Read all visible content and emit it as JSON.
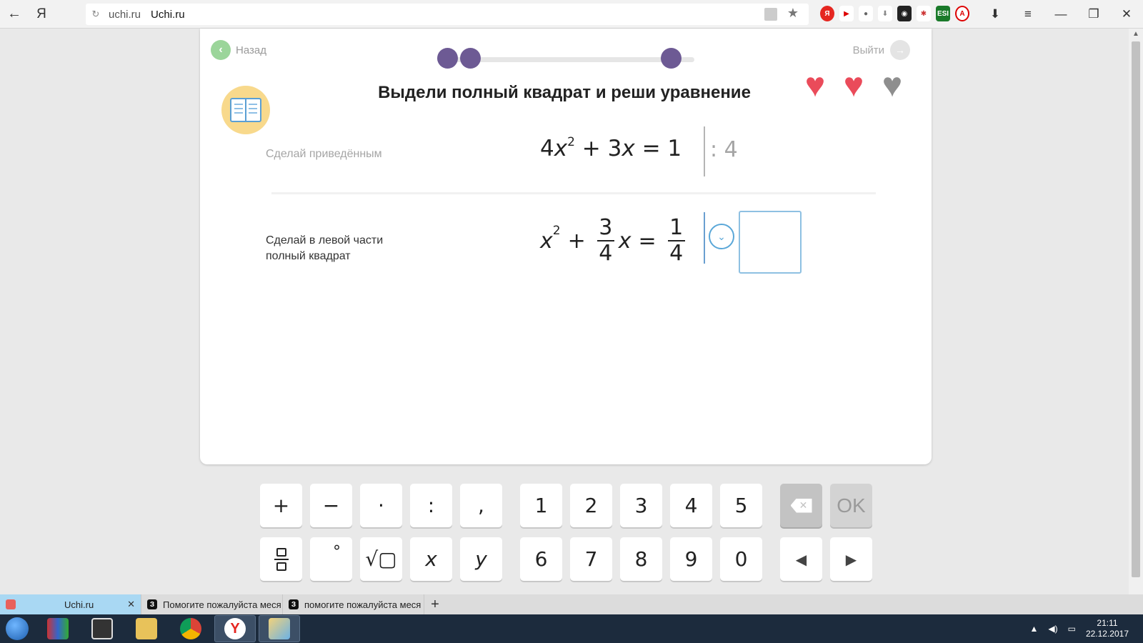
{
  "browser": {
    "back_icon": "←",
    "yandex_icon": "Я",
    "reload_icon": "↻",
    "domain": "uchi.ru",
    "page_title": "Uchi.ru",
    "star_icon": "★",
    "minimize": "—",
    "restore": "❐",
    "close": "✕",
    "menu": "≡",
    "download": "⬇"
  },
  "header": {
    "back_label": "Назад",
    "back_icon": "‹",
    "exit_label": "Выйти",
    "exit_icon": "→"
  },
  "task": {
    "title": "Выдели полный квадрат и реши уравнение",
    "lives_total": 3,
    "lives_remaining": 2,
    "colors": {
      "accent_purple": "#6d5a94",
      "heart_full": "#ea4b5a",
      "heart_empty": "#8e8e8e",
      "input_border": "#8ec0e2"
    }
  },
  "steps": [
    {
      "label": "Сделай приведённым",
      "equation": {
        "a": "4",
        "x": "x",
        "pow": "2",
        "plus": "+",
        "b": "3",
        "eq": "=",
        "rhs": "1"
      },
      "divisor": ": 4"
    },
    {
      "label_line1": "Сделай в левой части",
      "label_line2": "полный квадрат",
      "equation": {
        "x": "x",
        "pow": "2",
        "plus": "+",
        "frac1_num": "3",
        "frac1_den": "4",
        "x2": "x",
        "eq": "=",
        "frac2_num": "1",
        "frac2_den": "4"
      },
      "chevron_icon": "⌄"
    }
  ],
  "keyboard": {
    "row1": [
      "+",
      "−",
      "·",
      ":",
      ",",
      "1",
      "2",
      "3",
      "4",
      "5"
    ],
    "row2_x": "x",
    "row2_y": "y",
    "row2_sqrt": "√▢",
    "row2_deg": "°",
    "row2_digits": [
      "6",
      "7",
      "8",
      "9",
      "0"
    ],
    "backspace_icon": "✕",
    "ok_label": "OK",
    "left_arrow": "◀",
    "right_arrow": "▶"
  },
  "tabs": [
    {
      "label": "Uchi.ru",
      "active": true,
      "close": "✕"
    },
    {
      "label": "Помогите пожалуйста меся",
      "active": false,
      "fav": "З"
    },
    {
      "label": "помогите пожалуйста меся",
      "active": false,
      "fav": "З"
    }
  ],
  "tab_add": "+",
  "taskbar": {
    "time": "21:11",
    "date": "22.12.2017",
    "tray_up": "▲"
  }
}
